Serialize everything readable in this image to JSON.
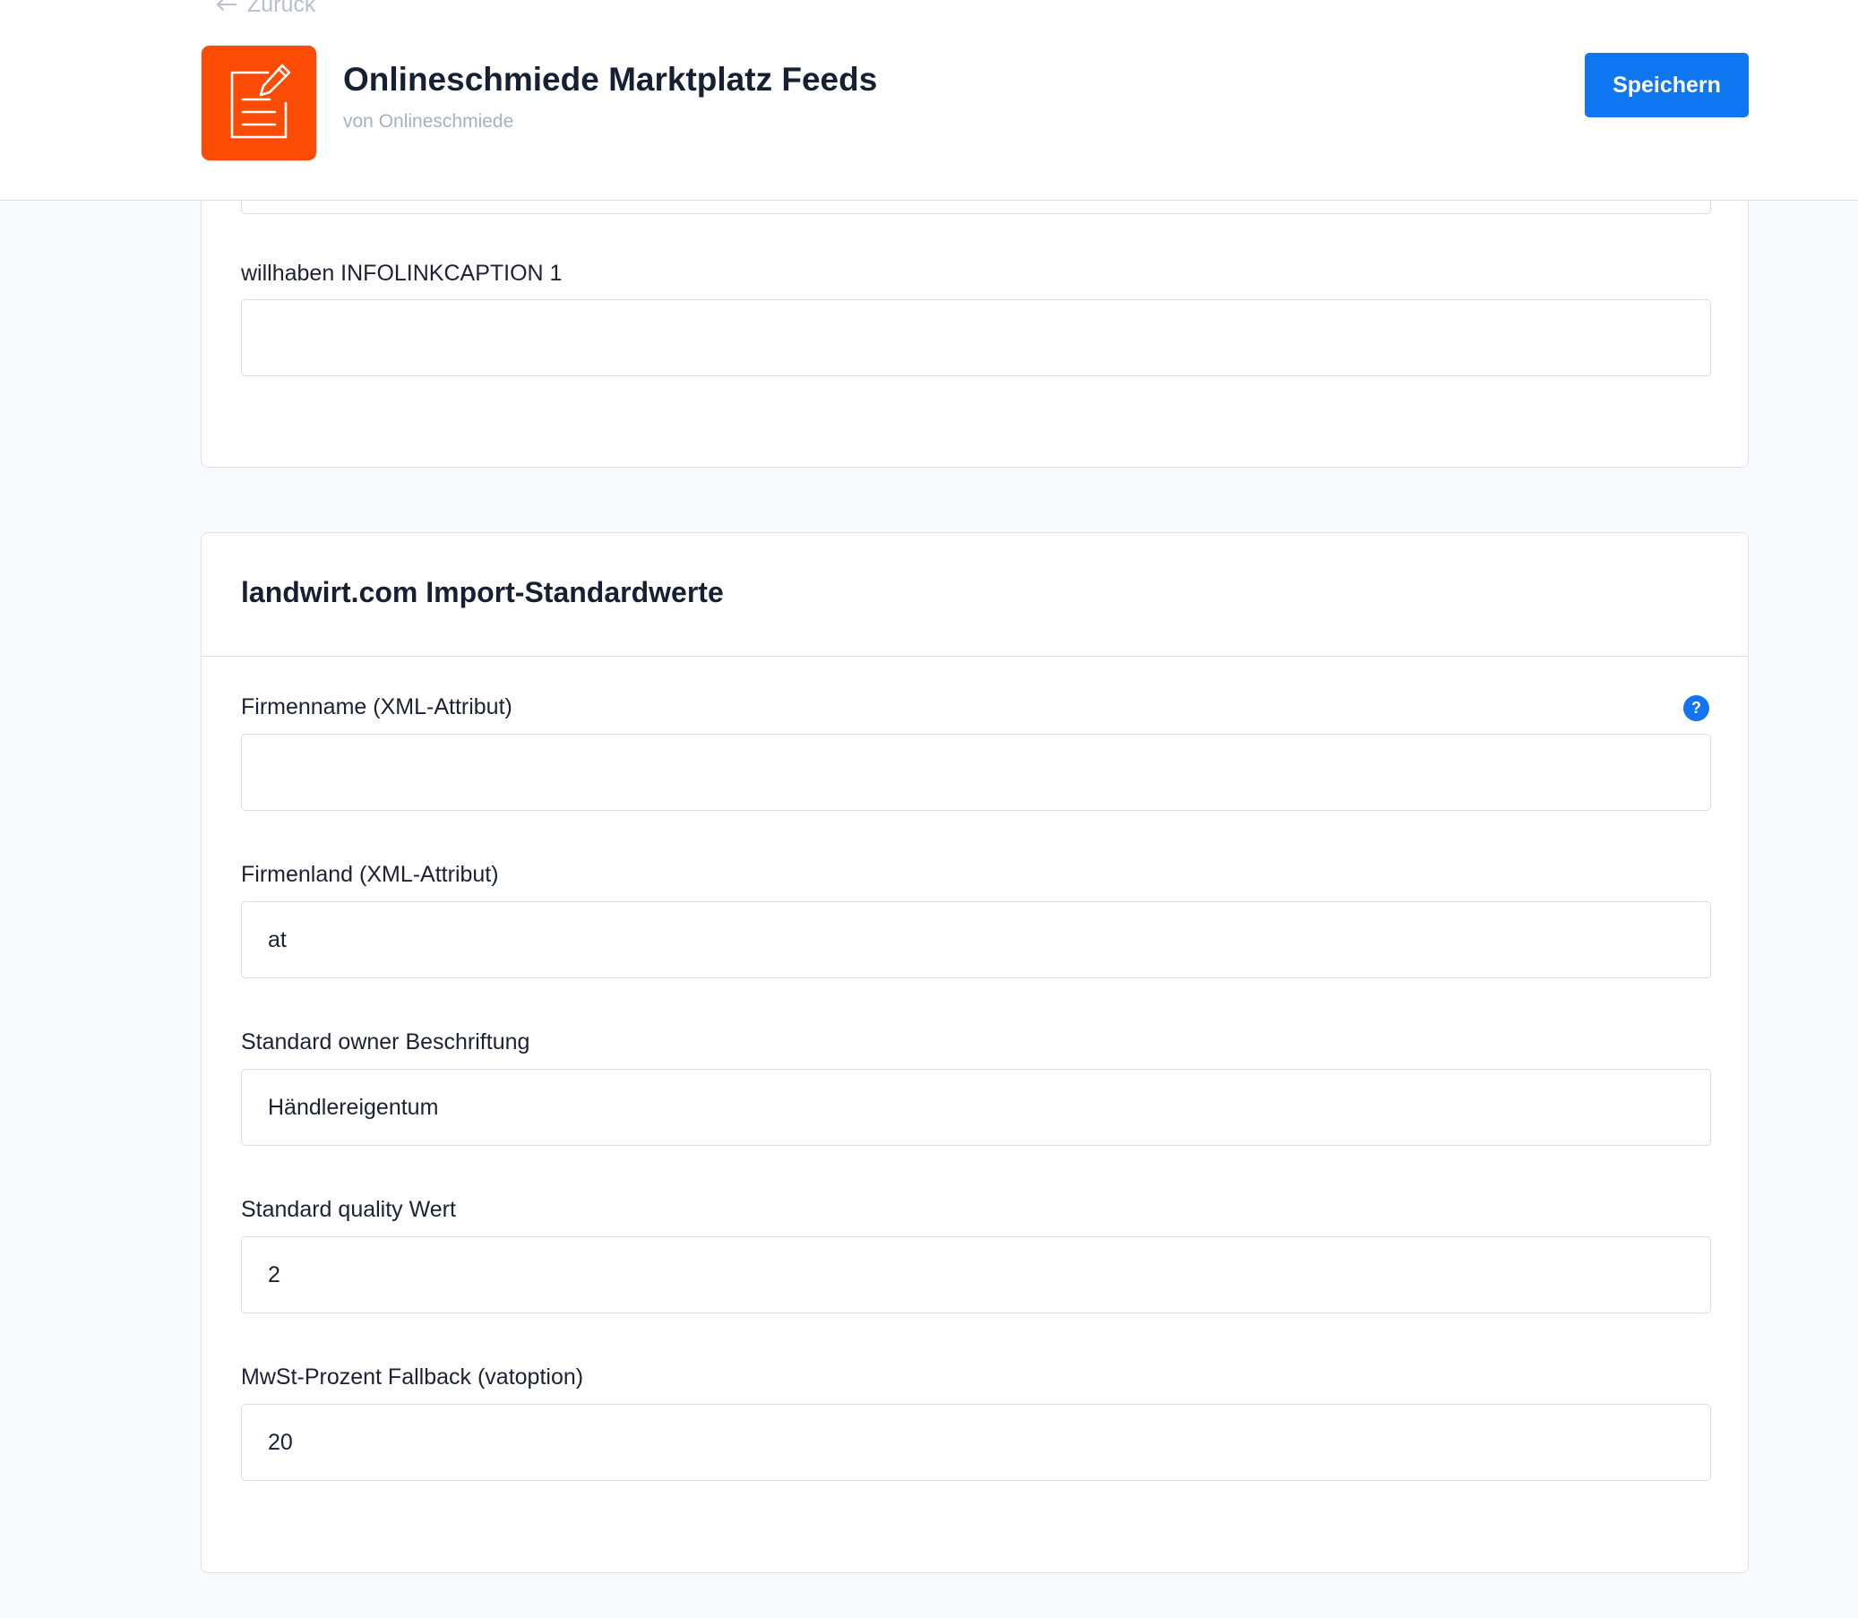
{
  "header": {
    "back_label": "Zurück",
    "app_title": "Onlineschmiede Marktplatz Feeds",
    "vendor": "von Onlineschmiede",
    "save_label": "Speichern",
    "icon": "note-edit-icon",
    "icon_color": "#fb4b05",
    "accent_color": "#0f76f2"
  },
  "willhaben_section": {
    "fields": [
      {
        "label": "willhaben INFOLINKCAPTION 1",
        "value": ""
      }
    ]
  },
  "landwirt_section": {
    "title": "landwirt.com Import-Standardwerte",
    "fields": [
      {
        "label": "Firmenname (XML-Attribut)",
        "value": "",
        "help_icon": "question-mark-icon"
      },
      {
        "label": "Firmenland (XML-Attribut)",
        "value": "at"
      },
      {
        "label": "Standard owner Beschriftung",
        "value": "Händlereigentum"
      },
      {
        "label": "Standard quality Wert",
        "value": "2"
      },
      {
        "label": "MwSt-Prozent Fallback (vatoption)",
        "value": "20"
      }
    ]
  }
}
